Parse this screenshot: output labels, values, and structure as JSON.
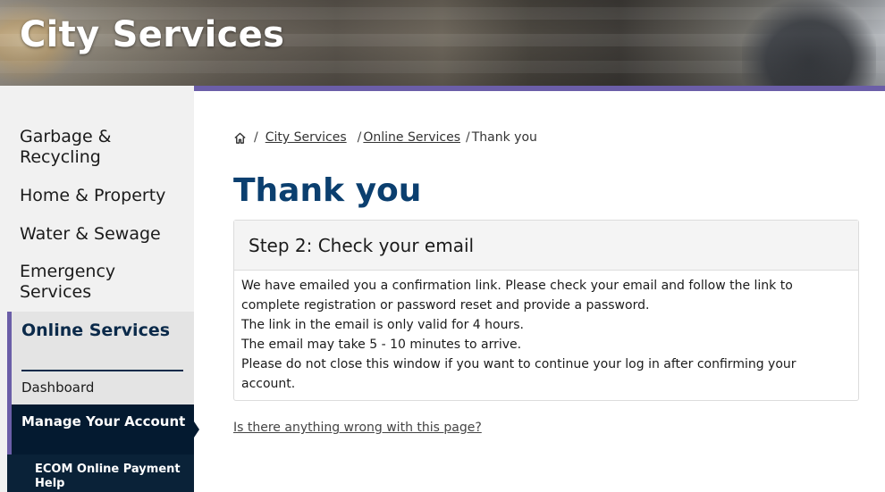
{
  "banner": {
    "title": "City Services"
  },
  "sidebar": {
    "items": [
      {
        "label": "Garbage & Recycling"
      },
      {
        "label": "Home & Property"
      },
      {
        "label": "Water & Sewage"
      },
      {
        "label": "Emergency Services"
      }
    ],
    "active_section": {
      "label": "Online Services"
    },
    "sub_items": [
      {
        "label": "Dashboard"
      },
      {
        "label": "Manage Your Account"
      },
      {
        "label": "ECOM Online Payment Help"
      }
    ]
  },
  "breadcrumb": {
    "home_icon": "home-icon",
    "items": [
      {
        "label": "City Services"
      },
      {
        "label": "Online Services"
      },
      {
        "label": "Thank you"
      }
    ],
    "separator": "/"
  },
  "main": {
    "title": "Thank you",
    "card": {
      "header": "Step 2: Check your email",
      "lines": [
        "We have emailed you a confirmation link. Please check your email and follow the link to complete registration or password reset and provide a password.",
        "The link in the email is only valid for 4 hours.",
        "The email may take 5 - 10 minutes to arrive.",
        "Please do not close this window if you want to continue your log in after confirming your account."
      ]
    },
    "feedback_link": "Is there anything wrong with this page?"
  },
  "colors": {
    "accent_purple": "#6b5ea8",
    "title_blue": "#0b3f6f",
    "nav_dark": "#041a30"
  }
}
